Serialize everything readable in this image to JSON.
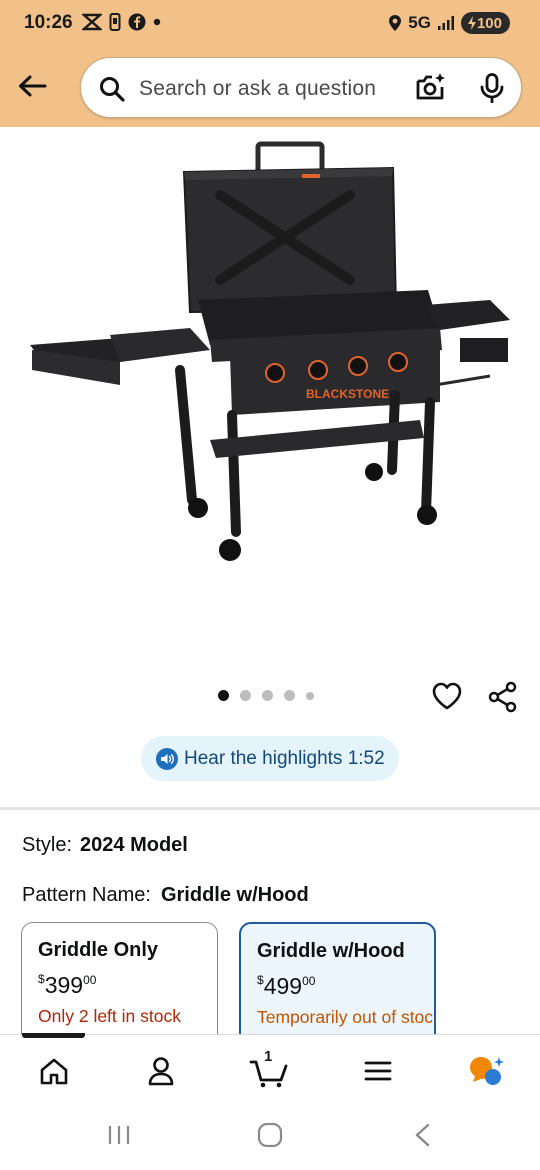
{
  "status_bar": {
    "time": "10:26",
    "network": "5G",
    "battery": "100"
  },
  "header": {
    "search_placeholder": "Search or ask a question"
  },
  "product": {
    "image_brand_label": "BLACKSTONE",
    "carousel": {
      "total_dots": 5,
      "active_index": 0
    }
  },
  "highlights": {
    "label": "Hear the highlights 1:52"
  },
  "variations": {
    "style_label": "Style:",
    "style_value": "2024 Model",
    "pattern_label": "Pattern Name:",
    "pattern_value": "Griddle w/Hood",
    "options": [
      {
        "name": "Griddle Only",
        "currency": "$",
        "dollars": "399",
        "cents": "00",
        "stock": "Only 2 left in stock",
        "selected": false
      },
      {
        "name": "Griddle w/Hood",
        "currency": "$",
        "dollars": "499",
        "cents": "00",
        "stock": "Temporarily out of stock",
        "selected": true
      }
    ]
  },
  "bottom_nav": {
    "cart_count": "1",
    "items": [
      "home-icon",
      "account-icon",
      "cart-icon",
      "menu-icon",
      "rufus-icon"
    ]
  },
  "colors": {
    "header_bg": "#f2c189",
    "link_blue": "#12497d",
    "stock_red": "#b12704",
    "selected_border": "#1e5a9c"
  }
}
